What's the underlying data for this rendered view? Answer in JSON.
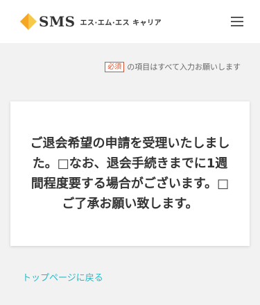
{
  "header": {
    "logo_text": "SMS",
    "logo_subtitle": "エス·エム·エス キャリア",
    "brand_colors": {
      "diamond_left": "#f5a623",
      "diamond_right": "#f7c948"
    },
    "menu_icon": "hamburger-menu-icon"
  },
  "notice": {
    "required_badge": "必須",
    "text": "の項目はすべて入力お願いします"
  },
  "card": {
    "message": "ご退会希望の申請を受理いたしました。□なお、退会手続きまでに1週間程度要する場合がございます。□ご了承お願い致します。"
  },
  "footer": {
    "back_link": "トップページに戻る",
    "link_color": "#2bb8c4"
  }
}
